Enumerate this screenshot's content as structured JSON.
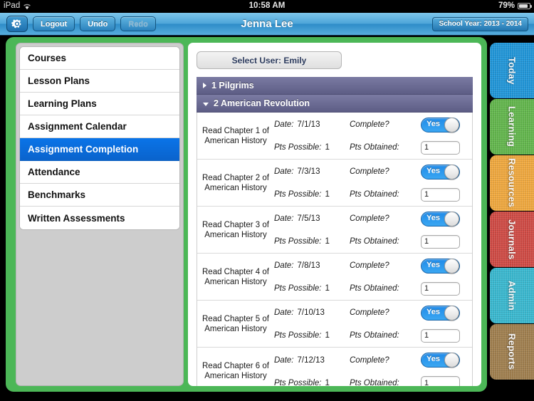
{
  "statusbar": {
    "carrier": "iPad",
    "wifi_icon": "wifi-icon",
    "time": "10:58 AM",
    "battery_percent": "79%",
    "battery_icon": "battery-icon"
  },
  "toolbar": {
    "gear_icon": "gear-icon",
    "logout_label": "Logout",
    "undo_label": "Undo",
    "redo_label": "Redo",
    "title": "Jenna Lee",
    "school_year_label": "School Year: 2013 - 2014"
  },
  "sidebar": {
    "items": [
      {
        "label": "Courses",
        "active": false
      },
      {
        "label": "Lesson Plans",
        "active": false
      },
      {
        "label": "Learning Plans",
        "active": false
      },
      {
        "label": "Assignment Calendar",
        "active": false
      },
      {
        "label": "Assignment Completion",
        "active": true
      },
      {
        "label": "Attendance",
        "active": false
      },
      {
        "label": "Benchmarks",
        "active": false
      },
      {
        "label": "Written Assessments",
        "active": false
      }
    ],
    "active_color": "#0a74e8"
  },
  "main": {
    "select_user_label": "Select User: Emily",
    "sections": [
      {
        "index": "1",
        "title": "1 Pilgrims",
        "expanded": false,
        "triangle_icon": "chevron-right-icon"
      },
      {
        "index": "2",
        "title": "2 American Revolution",
        "expanded": true,
        "triangle_icon": "chevron-down-icon"
      }
    ],
    "labels": {
      "date": "Date:",
      "pts_possible": "Pts Possible:",
      "complete": "Complete?",
      "pts_obtained": "Pts Obtained:"
    },
    "assignments": [
      {
        "title": "Read Chapter 1 of American History",
        "date": "7/1/13",
        "pts_possible": "1",
        "complete_label": "Yes",
        "complete": true,
        "pts_obtained": "1"
      },
      {
        "title": "Read Chapter 2 of American History",
        "date": "7/3/13",
        "pts_possible": "1",
        "complete_label": "Yes",
        "complete": true,
        "pts_obtained": "1"
      },
      {
        "title": "Read Chapter 3 of American History",
        "date": "7/5/13",
        "pts_possible": "1",
        "complete_label": "Yes",
        "complete": true,
        "pts_obtained": "1"
      },
      {
        "title": "Read Chapter 4 of American History",
        "date": "7/8/13",
        "pts_possible": "1",
        "complete_label": "Yes",
        "complete": true,
        "pts_obtained": "1"
      },
      {
        "title": "Read Chapter 5 of American History",
        "date": "7/10/13",
        "pts_possible": "1",
        "complete_label": "Yes",
        "complete": true,
        "pts_obtained": "1"
      },
      {
        "title": "Read Chapter 6 of American History",
        "date": "7/12/13",
        "pts_possible": "1",
        "complete_label": "Yes",
        "complete": true,
        "pts_obtained": "1"
      }
    ]
  },
  "tabs": [
    {
      "label": "Today",
      "color": "#2196d8"
    },
    {
      "label": "Learning",
      "color": "#63b64d"
    },
    {
      "label": "Resources",
      "color": "#efa83f"
    },
    {
      "label": "Journals",
      "color": "#cf4b45"
    },
    {
      "label": "Admin",
      "color": "#3ab8cf"
    },
    {
      "label": "Reports",
      "color": "#a07f4f"
    }
  ],
  "frame_color": "#4cb757"
}
